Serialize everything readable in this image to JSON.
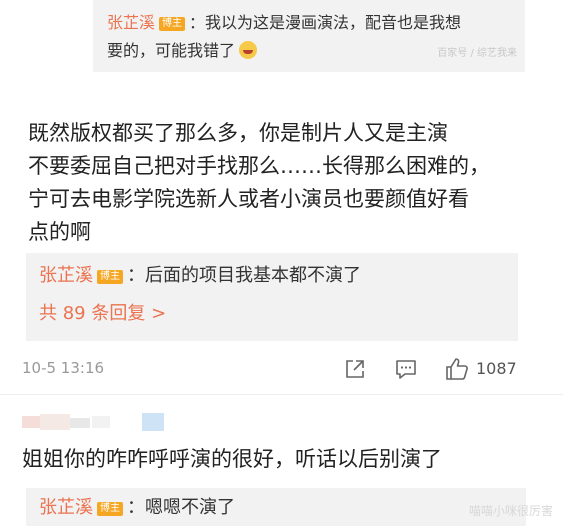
{
  "top_reply": {
    "name": "张芷溪",
    "badge": "博主",
    "line1_text": "：我以为这是漫画演法，配音也是我想",
    "line2_text": "要的，可能我错了",
    "watermark": "百家号 / 综艺我来"
  },
  "main_comment": {
    "lines": [
      "既然版权都买了那么多，你是制片人又是主演",
      "不要委屈自己把对手找那么……长得那么困难的，",
      "宁可去电影学院选新人或者小演员也要颜值好看",
      "点的啊"
    ]
  },
  "mid_reply": {
    "name": "张芷溪",
    "badge": "博主",
    "text": "：后面的项目我基本都不演了",
    "more_link": "共 89 条回复 >"
  },
  "meta": {
    "time": "10-5 13:16",
    "like_count": "1087",
    "icons": [
      "share-icon",
      "comment-icon",
      "like-icon"
    ]
  },
  "second_comment": {
    "text": "姐姐你的咋咋呼呼演的很好，听话以后别演了"
  },
  "bottom_reply": {
    "name": "张芷溪",
    "badge": "博主",
    "text": "：嗯嗯不演了",
    "watermark": "喵喵小咪很厉害"
  },
  "colors": {
    "name": "#eb7350",
    "badge": "#f5a623",
    "reply_bg": "#f2f2f2",
    "meta": "#999999"
  }
}
